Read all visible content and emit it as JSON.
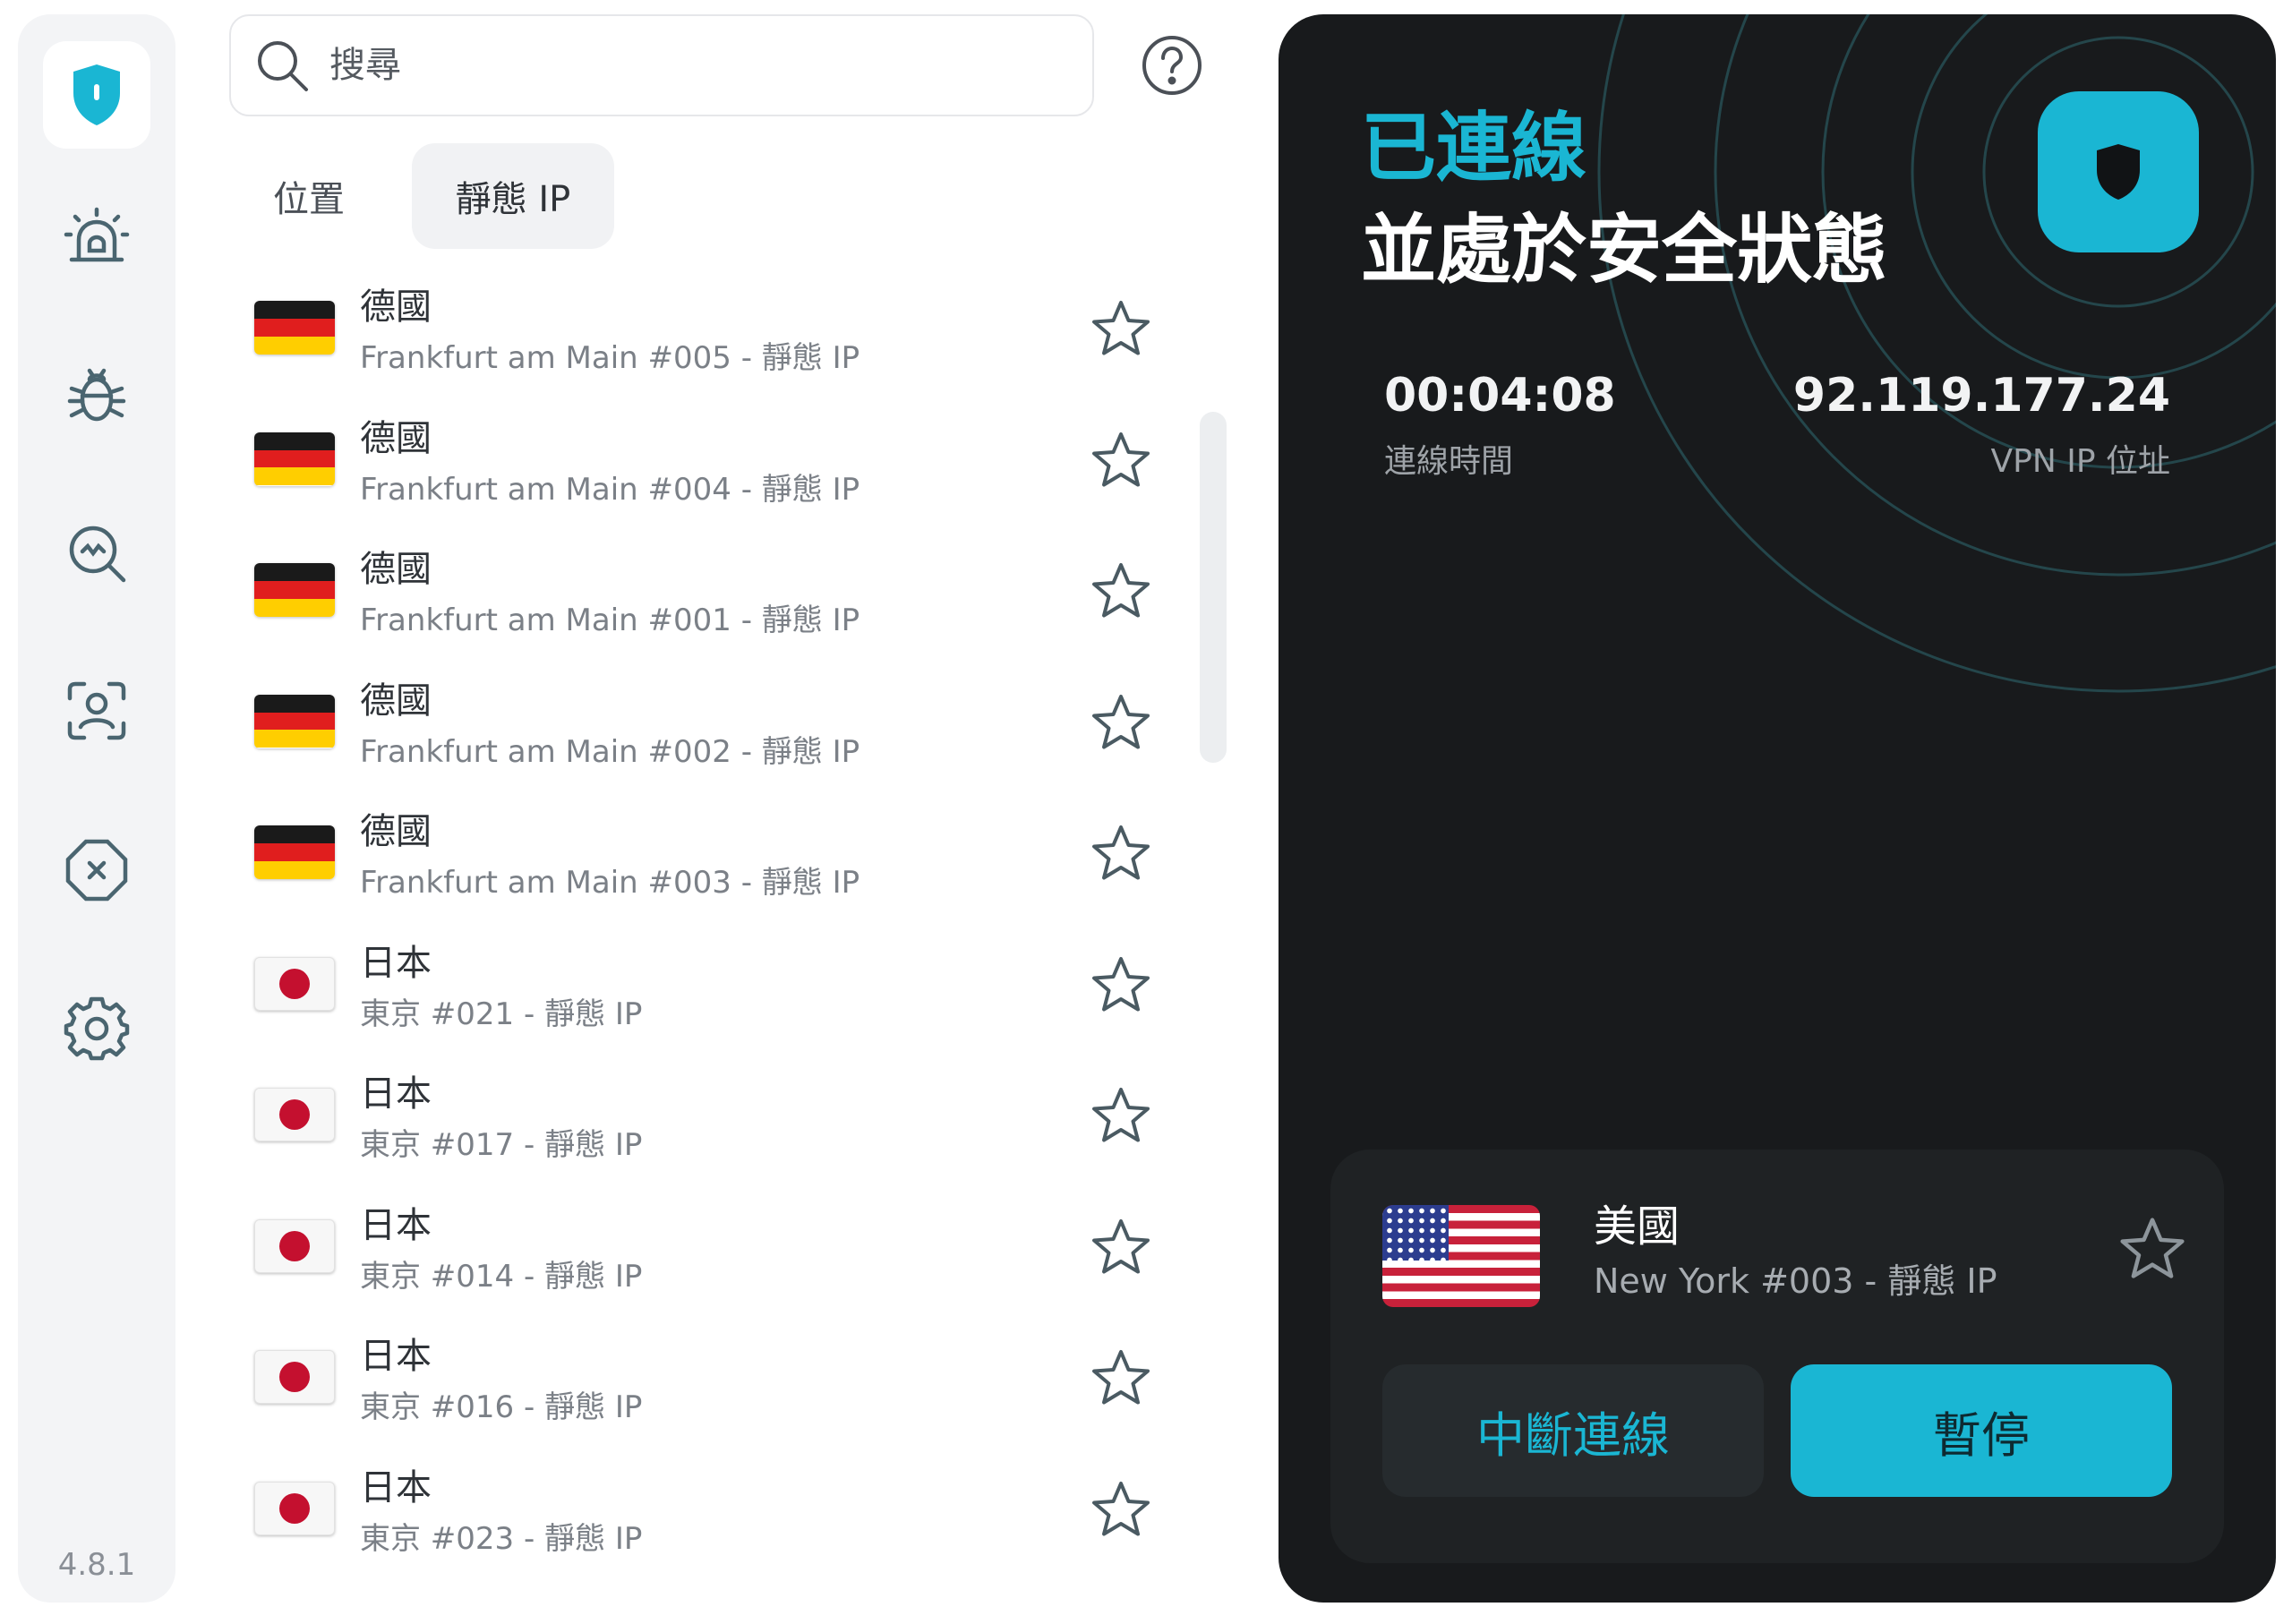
{
  "sidebar": {
    "items": [
      {
        "icon": "shield-icon"
      },
      {
        "icon": "alarm-icon"
      },
      {
        "icon": "bug-icon"
      },
      {
        "icon": "search-scan-icon"
      },
      {
        "icon": "face-scan-icon"
      },
      {
        "icon": "block-icon"
      },
      {
        "icon": "gear-icon"
      }
    ],
    "version": "4.8.1"
  },
  "search": {
    "placeholder": "搜尋"
  },
  "tabs": [
    {
      "label": "位置",
      "active": false
    },
    {
      "label": "靜態 IP",
      "active": true
    }
  ],
  "servers": [
    {
      "flag": "de",
      "country": "德國",
      "location": "Frankfurt am Main #005 - 靜態 IP"
    },
    {
      "flag": "de",
      "country": "德國",
      "location": "Frankfurt am Main #004 - 靜態 IP"
    },
    {
      "flag": "de",
      "country": "德國",
      "location": "Frankfurt am Main #001 - 靜態 IP"
    },
    {
      "flag": "de",
      "country": "德國",
      "location": "Frankfurt am Main #002 - 靜態 IP"
    },
    {
      "flag": "de",
      "country": "德國",
      "location": "Frankfurt am Main #003 - 靜態 IP"
    },
    {
      "flag": "jp",
      "country": "日本",
      "location": "東京 #021 - 靜態 IP"
    },
    {
      "flag": "jp",
      "country": "日本",
      "location": "東京 #017 - 靜態 IP"
    },
    {
      "flag": "jp",
      "country": "日本",
      "location": "東京 #014 - 靜態 IP"
    },
    {
      "flag": "jp",
      "country": "日本",
      "location": "東京 #016 - 靜態 IP"
    },
    {
      "flag": "jp",
      "country": "日本",
      "location": "東京 #023 - 靜態 IP"
    }
  ],
  "status": {
    "title": "已連線",
    "subtitle": "並處於安全狀態",
    "time_value": "00:04:08",
    "time_label": "連線時間",
    "ip_value": "92.119.177.24",
    "ip_label": "VPN IP 位址"
  },
  "connection": {
    "flag": "us",
    "country": "美國",
    "location": "New York #003 - 靜態 IP",
    "disconnect_label": "中斷連線",
    "pause_label": "暫停"
  },
  "colors": {
    "accent": "#1ab6d3",
    "panel_bg": "#181a1c",
    "sidebar_bg": "#f3f4f6"
  }
}
